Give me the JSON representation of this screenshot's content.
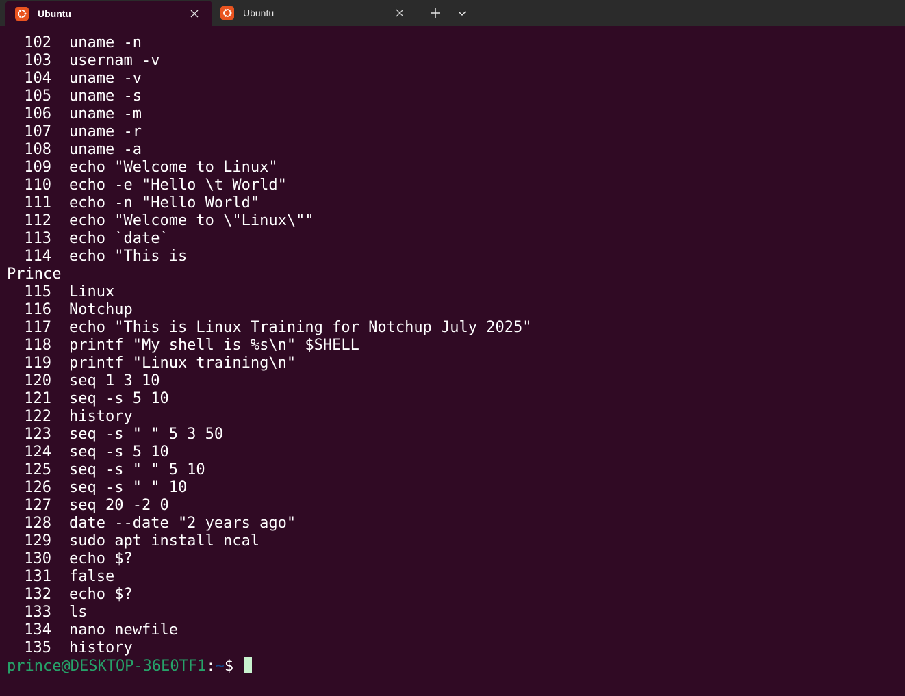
{
  "tabs": [
    {
      "title": "Ubuntu",
      "active": true
    },
    {
      "title": "Ubuntu",
      "active": false
    }
  ],
  "colors": {
    "terminal_bg": "#300a24",
    "tabbar_bg": "#2b2b2b",
    "prompt_user": "#26a269",
    "prompt_path": "#12488b",
    "ubuntu_orange": "#e95420"
  },
  "icons": {
    "tab": "ubuntu-logo-icon",
    "close": "close-icon",
    "new_tab": "plus-icon",
    "dropdown": "chevron-down-icon"
  },
  "history": [
    {
      "num": "102",
      "cmd": "uname -n"
    },
    {
      "num": "103",
      "cmd": "usernam -v"
    },
    {
      "num": "104",
      "cmd": "uname -v"
    },
    {
      "num": "105",
      "cmd": "uname -s"
    },
    {
      "num": "106",
      "cmd": "uname -m"
    },
    {
      "num": "107",
      "cmd": "uname -r"
    },
    {
      "num": "108",
      "cmd": "uname -a"
    },
    {
      "num": "109",
      "cmd": "echo \"Welcome to Linux\""
    },
    {
      "num": "110",
      "cmd": "echo -e \"Hello \\t World\""
    },
    {
      "num": "111",
      "cmd": "echo -n \"Hello World\""
    },
    {
      "num": "112",
      "cmd": "echo \"Welcome to \\\"Linux\\\"\""
    },
    {
      "num": "113",
      "cmd": "echo `date`"
    },
    {
      "num": "114",
      "cmd": "echo \"This is"
    },
    {
      "num": "",
      "cmd": "Prince",
      "raw": true
    },
    {
      "num": "115",
      "cmd": "Linux"
    },
    {
      "num": "116",
      "cmd": "Notchup"
    },
    {
      "num": "117",
      "cmd": "echo \"This is Linux Training for Notchup July 2025\""
    },
    {
      "num": "118",
      "cmd": "printf \"My shell is %s\\n\" $SHELL"
    },
    {
      "num": "119",
      "cmd": "printf \"Linux training\\n\""
    },
    {
      "num": "120",
      "cmd": "seq 1 3 10"
    },
    {
      "num": "121",
      "cmd": "seq -s 5 10"
    },
    {
      "num": "122",
      "cmd": "history"
    },
    {
      "num": "123",
      "cmd": "seq -s \" \" 5 3 50"
    },
    {
      "num": "124",
      "cmd": "seq -s 5 10"
    },
    {
      "num": "125",
      "cmd": "seq -s \" \" 5 10"
    },
    {
      "num": "126",
      "cmd": "seq -s \" \" 10"
    },
    {
      "num": "127",
      "cmd": "seq 20 -2 0"
    },
    {
      "num": "128",
      "cmd": "date --date \"2 years ago\""
    },
    {
      "num": "129",
      "cmd": "sudo apt install ncal"
    },
    {
      "num": "130",
      "cmd": "echo $?"
    },
    {
      "num": "131",
      "cmd": "false"
    },
    {
      "num": "132",
      "cmd": "echo $?"
    },
    {
      "num": "133",
      "cmd": "ls"
    },
    {
      "num": "134",
      "cmd": "nano newfile"
    },
    {
      "num": "135",
      "cmd": "history"
    }
  ],
  "prompt": {
    "user_host": "prince@DESKTOP-36E0TF1",
    "colon": ":",
    "path": "~",
    "symbol": "$"
  }
}
